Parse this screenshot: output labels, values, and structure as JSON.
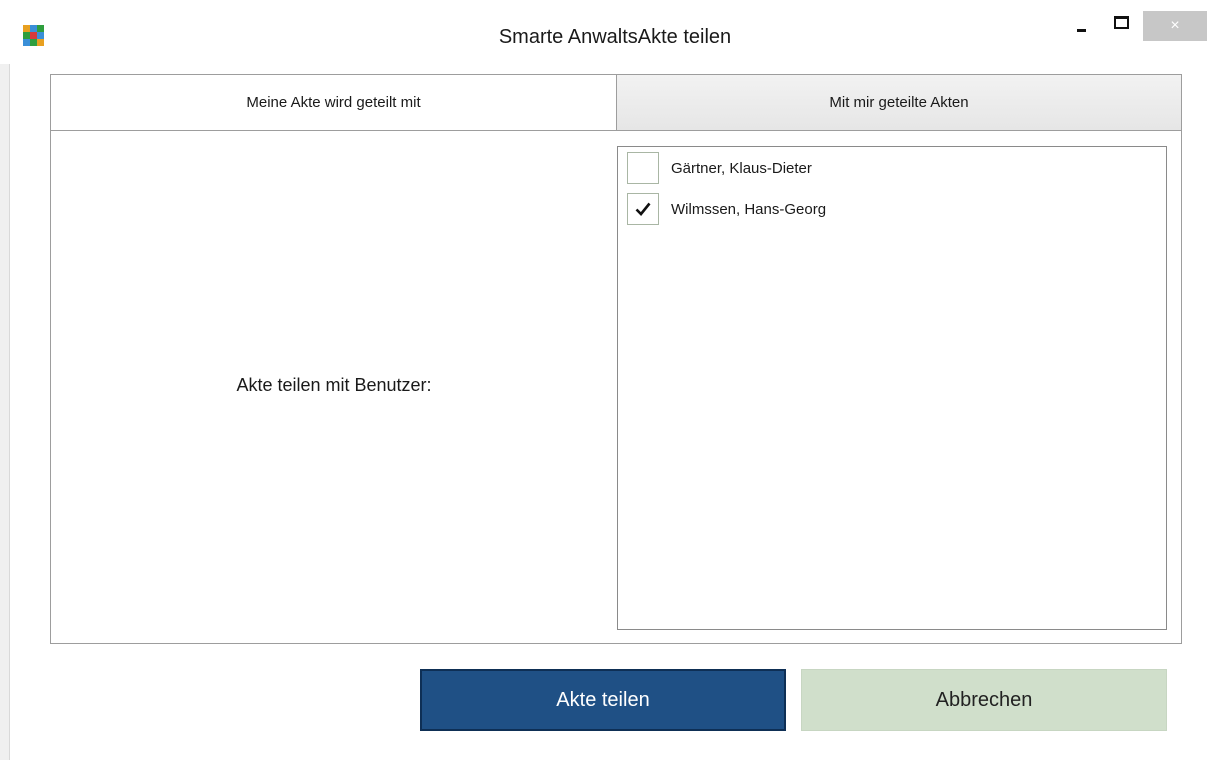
{
  "window": {
    "title": "Smarte AnwaltsAkte teilen",
    "close_glyph": "×"
  },
  "tabs": [
    {
      "label": "Meine Akte wird geteilt mit",
      "active": true
    },
    {
      "label": "Mit mir geteilte Akten",
      "active": false
    }
  ],
  "share_label": "Akte teilen mit Benutzer:",
  "users": [
    {
      "name": "Gärtner, Klaus-Dieter",
      "checked": false
    },
    {
      "name": "Wilmssen, Hans-Georg",
      "checked": true
    }
  ],
  "buttons": {
    "share_label": "Akte teilen",
    "cancel_label": "Abbrechen"
  },
  "colors": {
    "primary_button": "#1f5085",
    "secondary_button": "#d0dfcb",
    "close_button": "#c7c7c7"
  },
  "icons": {
    "app": "app-logo-icon",
    "minimize": "minimize-icon",
    "maximize": "maximize-icon",
    "close": "close-icon",
    "check": "checkmark-icon"
  }
}
